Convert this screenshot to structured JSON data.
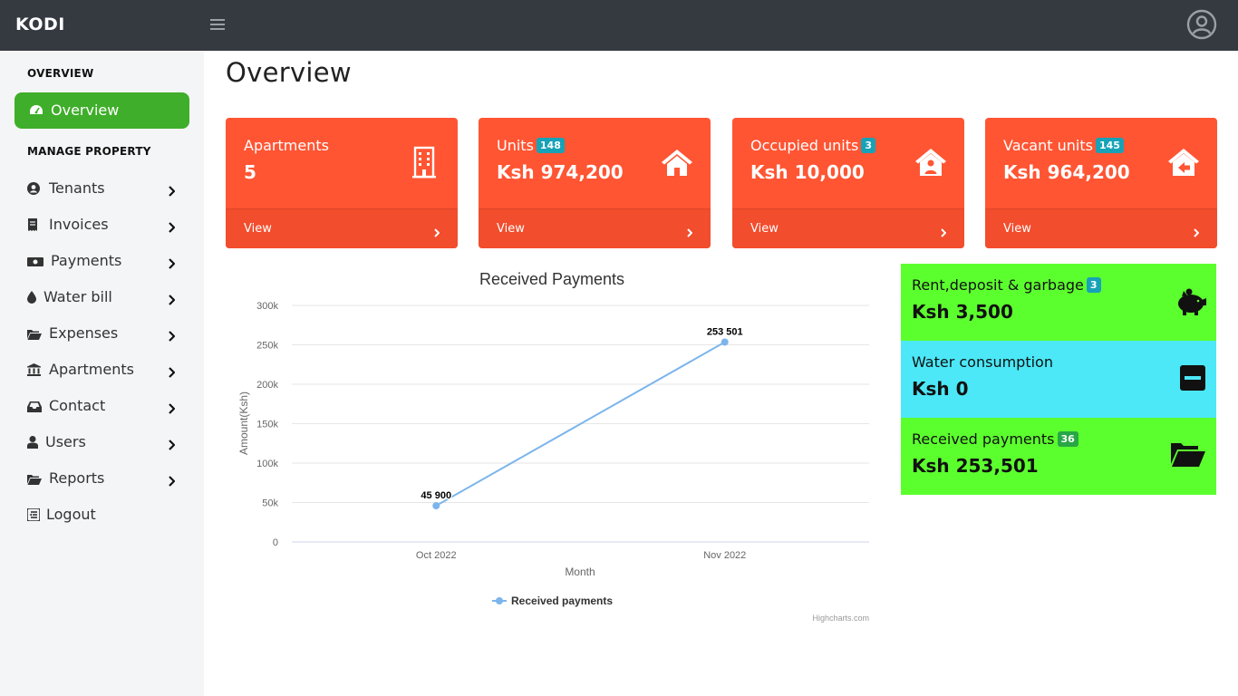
{
  "app": {
    "brand": "KODI"
  },
  "sidebar": {
    "section_overview": "OVERVIEW",
    "active_item": "Overview",
    "section_manage": "MANAGE PROPERTY",
    "items": [
      {
        "label": "Tenants",
        "icon": "user-circle-icon"
      },
      {
        "label": "Invoices",
        "icon": "receipt-icon"
      },
      {
        "label": "Payments",
        "icon": "money-icon"
      },
      {
        "label": "Water bill",
        "icon": "droplet-icon"
      },
      {
        "label": "Expenses",
        "icon": "folder-open-icon"
      },
      {
        "label": "Apartments",
        "icon": "bank-icon"
      },
      {
        "label": "Contact",
        "icon": "inbox-icon"
      },
      {
        "label": "Users",
        "icon": "user-icon"
      },
      {
        "label": "Reports",
        "icon": "folder-open-icon"
      },
      {
        "label": "Logout",
        "icon": "logout-icon"
      }
    ]
  },
  "main": {
    "title": "Overview",
    "cards": [
      {
        "label": "Apartments",
        "badge": "",
        "value": "5",
        "footer": "View",
        "icon": "building-icon"
      },
      {
        "label": "Units",
        "badge": "148",
        "value": "Ksh 974,200",
        "footer": "View",
        "icon": "home-icon"
      },
      {
        "label": "Occupied units",
        "badge": "3",
        "value": "Ksh 10,000",
        "footer": "View",
        "icon": "house-user-icon"
      },
      {
        "label": "Vacant units",
        "badge": "145",
        "value": "Ksh 964,200",
        "footer": "View",
        "icon": "house-arrow-icon"
      }
    ],
    "info_boxes": [
      {
        "label": "Rent,deposit & garbage",
        "badge": "3",
        "badge_color": "#17a2b8",
        "value": "Ksh 3,500",
        "bg": "#5cff2e",
        "icon": "piggy-bank-icon"
      },
      {
        "label": "Water consumption",
        "badge": "",
        "badge_color": "",
        "value": "Ksh 0",
        "bg": "#4ce8f7",
        "icon": "minus-square-icon"
      },
      {
        "label": "Received payments",
        "badge": "36",
        "badge_color": "#28a745",
        "value": "Ksh 253,501",
        "bg": "#5cff2e",
        "icon": "folder-open-icon"
      }
    ]
  },
  "chart_data": {
    "type": "line",
    "title": "Received Payments",
    "xlabel": "Month",
    "ylabel": "Amount(Ksh)",
    "categories": [
      "Oct 2022",
      "Nov 2022"
    ],
    "series": [
      {
        "name": "Received payments",
        "values": [
          45900,
          253501
        ],
        "color": "#7cb5ec"
      }
    ],
    "data_labels": [
      "45 900",
      "253 501"
    ],
    "ylim": [
      0,
      300000
    ],
    "yticks": [
      0,
      50000,
      100000,
      150000,
      200000,
      250000,
      300000
    ],
    "ytick_labels": [
      "0",
      "50k",
      "100k",
      "150k",
      "200k",
      "250k",
      "300k"
    ],
    "grid": true,
    "legend": "bottom",
    "credits": "Highcharts.com"
  }
}
